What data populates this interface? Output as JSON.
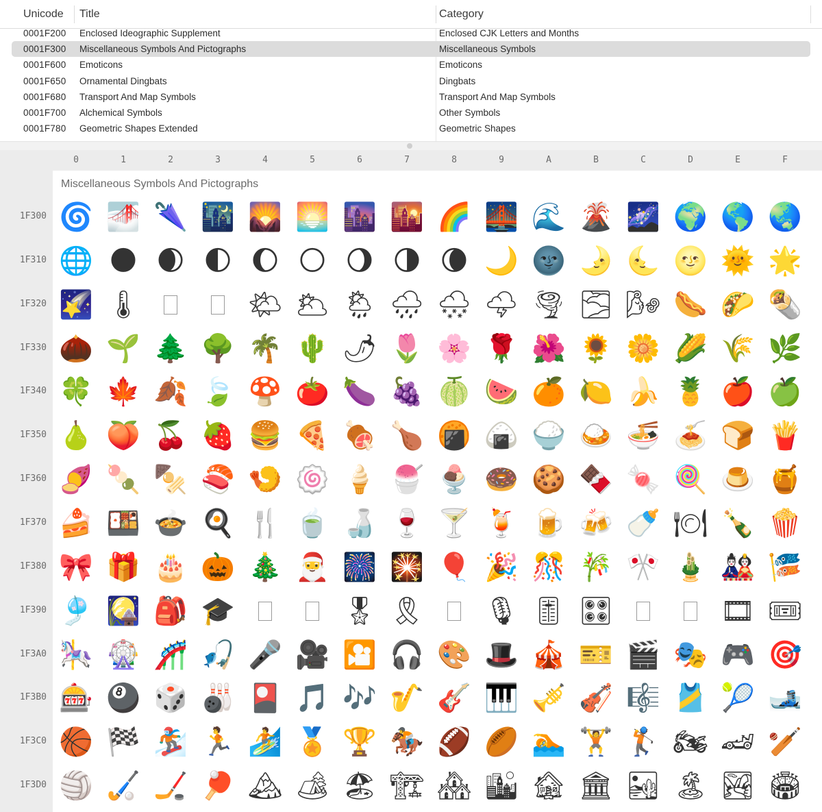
{
  "table": {
    "headers": {
      "unicode": "Unicode",
      "title": "Title",
      "category": "Category"
    },
    "rows": [
      {
        "code": "0001F200",
        "title": "Enclosed Ideographic Supplement",
        "category": "Enclosed CJK Letters and Months",
        "selected": false
      },
      {
        "code": "0001F300",
        "title": "Miscellaneous Symbols And Pictographs",
        "category": "Miscellaneous Symbols",
        "selected": true
      },
      {
        "code": "0001F600",
        "title": "Emoticons",
        "category": "Emoticons",
        "selected": false
      },
      {
        "code": "0001F650",
        "title": "Ornamental Dingbats",
        "category": "Dingbats",
        "selected": false
      },
      {
        "code": "0001F680",
        "title": "Transport And Map Symbols",
        "category": "Transport And Map Symbols",
        "selected": false
      },
      {
        "code": "0001F700",
        "title": "Alchemical Symbols",
        "category": "Other Symbols",
        "selected": false
      },
      {
        "code": "0001F780",
        "title": "Geometric Shapes Extended",
        "category": "Geometric Shapes",
        "selected": false
      }
    ]
  },
  "grid": {
    "block_title": "Miscellaneous Symbols And Pictographs",
    "columns": [
      "0",
      "1",
      "2",
      "3",
      "4",
      "5",
      "6",
      "7",
      "8",
      "9",
      "A",
      "B",
      "C",
      "D",
      "E",
      "F"
    ],
    "rows": [
      {
        "label": "1F300",
        "glyphs": [
          "🌀",
          "🌁",
          "🌂",
          "🌃",
          "🌄",
          "🌅",
          "🌆",
          "🌇",
          "🌈",
          "🌉",
          "🌊",
          "🌋",
          "🌌",
          "🌍",
          "🌎",
          "🌏"
        ]
      },
      {
        "label": "1F310",
        "glyphs": [
          "🌐",
          "🌑",
          "🌒",
          "🌓",
          "🌔",
          "🌕",
          "🌖",
          "🌗",
          "🌘",
          "🌙",
          "🌚",
          "🌛",
          "🌜",
          "🌝",
          "🌞",
          "🌟"
        ]
      },
      {
        "label": "1F320",
        "glyphs": [
          "🌠",
          "🌡",
          "",
          "",
          "🌤",
          "🌥",
          "🌦",
          "🌧",
          "🌨",
          "🌩",
          "🌪",
          "🌫",
          "🌬",
          "🌭",
          "🌮",
          "🌯"
        ]
      },
      {
        "label": "1F330",
        "glyphs": [
          "🌰",
          "🌱",
          "🌲",
          "🌳",
          "🌴",
          "🌵",
          "🌶",
          "🌷",
          "🌸",
          "🌹",
          "🌺",
          "🌻",
          "🌼",
          "🌽",
          "🌾",
          "🌿"
        ]
      },
      {
        "label": "1F340",
        "glyphs": [
          "🍀",
          "🍁",
          "🍂",
          "🍃",
          "🍄",
          "🍅",
          "🍆",
          "🍇",
          "🍈",
          "🍉",
          "🍊",
          "🍋",
          "🍌",
          "🍍",
          "🍎",
          "🍏"
        ]
      },
      {
        "label": "1F350",
        "glyphs": [
          "🍐",
          "🍑",
          "🍒",
          "🍓",
          "🍔",
          "🍕",
          "🍖",
          "🍗",
          "🍘",
          "🍙",
          "🍚",
          "🍛",
          "🍜",
          "🍝",
          "🍞",
          "🍟"
        ]
      },
      {
        "label": "1F360",
        "glyphs": [
          "🍠",
          "🍡",
          "🍢",
          "🍣",
          "🍤",
          "🍥",
          "🍦",
          "🍧",
          "🍨",
          "🍩",
          "🍪",
          "🍫",
          "🍬",
          "🍭",
          "🍮",
          "🍯"
        ]
      },
      {
        "label": "1F370",
        "glyphs": [
          "🍰",
          "🍱",
          "🍲",
          "🍳",
          "🍴",
          "🍵",
          "🍶",
          "🍷",
          "🍸",
          "🍹",
          "🍺",
          "🍻",
          "🍼",
          "🍽",
          "🍾",
          "🍿"
        ]
      },
      {
        "label": "1F380",
        "glyphs": [
          "🎀",
          "🎁",
          "🎂",
          "🎃",
          "🎄",
          "🎅",
          "🎆",
          "🎇",
          "🎈",
          "🎉",
          "🎊",
          "🎋",
          "🎌",
          "🎍",
          "🎎",
          "🎏"
        ]
      },
      {
        "label": "1F390",
        "glyphs": [
          "🎐",
          "🎑",
          "🎒",
          "🎓",
          "",
          "",
          "🎖",
          "🎗",
          "",
          "🎙",
          "🎚",
          "🎛",
          "",
          "",
          "🎞",
          "🎟"
        ]
      },
      {
        "label": "1F3A0",
        "glyphs": [
          "🎠",
          "🎡",
          "🎢",
          "🎣",
          "🎤",
          "🎥",
          "🎦",
          "🎧",
          "🎨",
          "🎩",
          "🎪",
          "🎫",
          "🎬",
          "🎭",
          "🎮",
          "🎯"
        ]
      },
      {
        "label": "1F3B0",
        "glyphs": [
          "🎰",
          "🎱",
          "🎲",
          "🎳",
          "🎴",
          "🎵",
          "🎶",
          "🎷",
          "🎸",
          "🎹",
          "🎺",
          "🎻",
          "🎼",
          "🎽",
          "🎾",
          "🎿"
        ]
      },
      {
        "label": "1F3C0",
        "glyphs": [
          "🏀",
          "🏁",
          "🏂",
          "🏃",
          "🏄",
          "🏅",
          "🏆",
          "🏇",
          "🏈",
          "🏉",
          "🏊",
          "🏋",
          "🏌",
          "🏍",
          "🏎",
          "🏏"
        ]
      },
      {
        "label": "1F3D0",
        "glyphs": [
          "🏐",
          "🏑",
          "🏒",
          "🏓",
          "🏔",
          "🏕",
          "🏖",
          "🏗",
          "🏘",
          "🏙",
          "🏚",
          "🏛",
          "🏜",
          "🏝",
          "🏞",
          "🏟"
        ]
      }
    ]
  }
}
